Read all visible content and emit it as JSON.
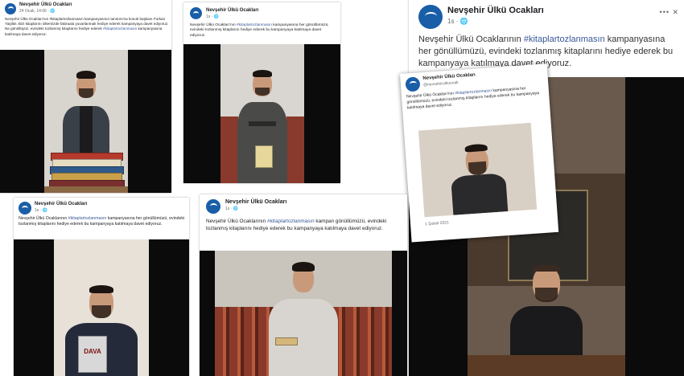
{
  "page": "Nevşehir Ülkü Ocakları",
  "posts": [
    {
      "author": "Nevşehir Ülkü Ocakları",
      "meta": "24 Ocak, 14:06 · 🌐",
      "text_before": "Nevşehir Ülkü Ocakları'nın #kitaplartozlanmasın kampanyasının tanıtımı'na konuk başkanı Furkan Yaşiltin. Bizi kitaplarını ülkemizde fakiraala yuvarlanmak hediye ederek kampanyaya davet ediyoruz. Ne gönüllüyüz, evindeki tozlanmış kitaplarını hediye ederek ",
      "hashtag": "#kitaplartozlanmasın",
      "text_after": " kampanyasına katılmaya davet ediyoruz."
    },
    {
      "author": "Nevşehir Ülkü Ocakları",
      "meta": "1s · 🌐",
      "text_before": "Nevşehir Ülkü Ocakları'nın ",
      "hashtag": "#kitaplartozlanmasın",
      "text_after": " kampanyasına her gönüllümüzü, evindeki tozlanmış kitaplarını hediye ederek bu kampanyaya katılmaya davet ediyoruz."
    },
    {
      "author": "Nevşehir Ülkü Ocakları",
      "meta": "1s · 🌐",
      "text_before": "Nevşehir Ülkü Ocaklarının ",
      "hashtag": "#kitaplartozlanmasın",
      "text_after": " kampanyasına her gönüllümüzü, evindeki tozlanmış kitaplarını hediye ederek bu kampanyaya katılmaya davet ediyoruz."
    },
    {
      "author": "Nevşehir Ülkü Ocakları",
      "meta": "1s · 🌐",
      "text_before": "Nevşehir Ülkü Ocaklarının ",
      "hashtag": "#kitaplartozlanmasın",
      "text_after": " kampanyasına her gönüllümüzü, evindeki tozlanmış kitaplarını hediye ederek bu kampanyaya katılmaya davet ediyoruz."
    },
    {
      "author": "Nevşehir Ülkü Ocakları",
      "meta": "1s · 🌐",
      "text_before": "Nevşehir Ülkü Ocaklarının ",
      "hashtag": "#kitaplartozlanmasın",
      "text_after": " kampan gönüllümüzü, evindeki tozlanmış kitaplarını hediye ederek bu kampanyaya katılmaya davet ediyoruz."
    }
  ],
  "tweet": {
    "author": "Nevşehir Ülkü Ocakları",
    "handle": "@nevsehirulkuocak",
    "text_before": "Nevşehir Ülkü Ocakları'nın ",
    "hashtag": "#kitaplartozlanmasın",
    "text_after": " kampanyasına her gönüllümüzü, evindeki tozlanmış kitaplarını hediye ederek bu kampanyaya katılmaya davet ediyoruz.",
    "footer": "1 Şubat 2021"
  },
  "book_title": "DAVA",
  "menu_glyph": "•••",
  "close_glyph": "✕",
  "colors": {
    "brand": "#1a5ea8",
    "link": "#385898",
    "video_bg": "#0b0b0b"
  }
}
